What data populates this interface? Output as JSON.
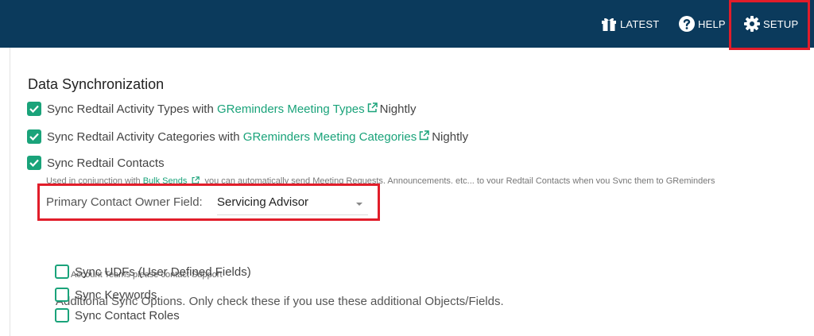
{
  "topbar": {
    "latest_label": "LATEST",
    "help_label": "HELP",
    "setup_label": "SETUP"
  },
  "section": {
    "title": "Data Synchronization"
  },
  "sync_rows": [
    {
      "prefix": "Sync Redtail Activity Types with",
      "link": "GReminders Meeting Types",
      "suffix": "Nightly",
      "checked": true
    },
    {
      "prefix": "Sync Redtail Activity Categories with",
      "link": "GReminders Meeting Categories",
      "suffix": "Nightly",
      "checked": true
    },
    {
      "prefix": "Sync Redtail Contacts",
      "checked": true
    }
  ],
  "contacts_note": {
    "prefix": "Used in conjunction with",
    "link": "Bulk Sends",
    "suffix": "you can automatically send Meeting Requests, Announcements, etc... to your Redtail Contacts when you Sync them to GReminders"
  },
  "owner_field": {
    "label": "Primary Contact Owner Field:",
    "value": "Servicing Advisor"
  },
  "support_note": "For Account Teams please contact Support",
  "additional": {
    "heading": "Additional Sync Options. Only check these if you use these additional Objects/Fields.",
    "options": [
      {
        "label": "Sync UDFs (User Defined Fields)",
        "checked": false
      },
      {
        "label": "Sync Keywords",
        "checked": false
      },
      {
        "label": "Sync Contact Roles",
        "checked": false
      }
    ]
  },
  "colors": {
    "topbar": "#0b3a5c",
    "accent": "#1aa37a",
    "highlight": "#e11d2a"
  },
  "icons": [
    "gift-icon",
    "help-circle-icon",
    "gear-icon",
    "external-link-icon",
    "check-icon",
    "chevron-down-icon"
  ]
}
